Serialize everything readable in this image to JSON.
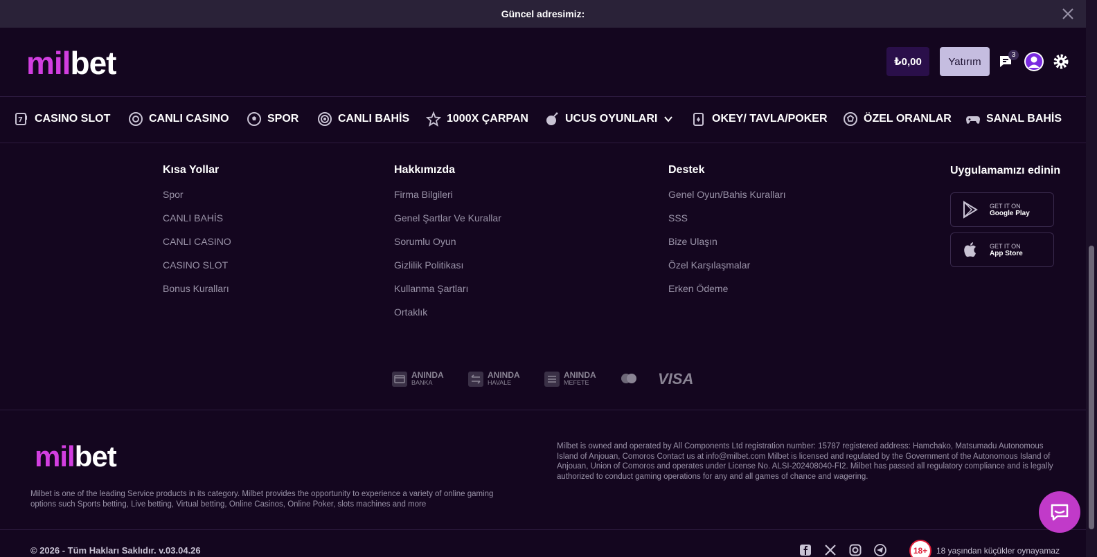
{
  "topbar": {
    "message": "Güncel adresimiz:"
  },
  "header": {
    "logo": {
      "part1": "mil",
      "part2": "bet"
    },
    "balance": "₺0,00",
    "deposit_label": "Yatırım",
    "notification_count": "3"
  },
  "nav": {
    "items": [
      {
        "label": "CASINO SLOT",
        "icon": "slot-icon"
      },
      {
        "label": "CANLI CASINO",
        "icon": "chip-icon"
      },
      {
        "label": "SPOR",
        "icon": "soccer-ball-icon"
      },
      {
        "label": "CANLI BAHİS",
        "icon": "live-icon"
      },
      {
        "label": "1000X ÇARPAN",
        "icon": "star-icon"
      },
      {
        "label": "UCUS OYUNLARI",
        "icon": "bomb-icon"
      },
      {
        "label": "OKEY/ TAVLA/POKER",
        "icon": "cards-icon"
      },
      {
        "label": "ÖZEL ORANLAR",
        "icon": "ball-icon"
      },
      {
        "label": "SANAL BAHİS",
        "icon": "gamepad-icon"
      }
    ]
  },
  "footer": {
    "columns": [
      {
        "title": "Kısa Yollar",
        "links": [
          "Spor",
          "CANLI BAHİS",
          "CANLI CASINO",
          "CASINO SLOT",
          "Bonus Kuralları"
        ]
      },
      {
        "title": "Hakkımızda",
        "links": [
          "Firma Bilgileri",
          "Genel Şartlar Ve Kurallar",
          "Sorumlu Oyun",
          "Gizlilik Politikası",
          "Kullanma Şartları",
          "Ortaklık"
        ]
      },
      {
        "title": "Destek",
        "links": [
          "Genel Oyun/Bahis Kuralları",
          "SSS",
          "Bize Ulaşın",
          "Özel Karşılaşmalar",
          "Erken Ödeme"
        ]
      }
    ],
    "app": {
      "title": "Uygulamamızı edinin",
      "google": {
        "small": "GET IT ON",
        "big": "Google Play"
      },
      "apple": {
        "small": "GET IT ON",
        "big": "App Store"
      }
    },
    "payments": [
      {
        "t1": "ANINDA",
        "t2": "BANKA"
      },
      {
        "t1": "ANINDA",
        "t2": "HAVALE"
      },
      {
        "t1": "ANINDA",
        "t2": "MEFETE"
      }
    ],
    "visa": "VISA",
    "about": "Milbet is one of the leading Service products in its category. Milbet provides the opportunity to experience a variety of online gaming options such Sports betting, Live betting, Virtual betting, Online Casinos, Online Poker, slots machines and more",
    "legal": "Milbet is owned and operated by All Components Ltd registration number: 15787 registered address: Hamchako, Matsumadu Autonomous Island of Anjouan, Comoros Contact us at info@milbet.com Milbet is licensed and regulated by the Government of the Autonomous Island of Anjouan, Union of Comoros and operates under License No. ALSI-202408040-FI2. Milbet has passed all regulatory compliance and is legally authorized to conduct gaming operations for any and all games of chance and wagering.",
    "copyright": "© 2026 - Tüm Hakları Saklıdır. v.03.04.26",
    "age_badge": "18+",
    "age_text": "18 yaşından küçükler oynayamaz"
  },
  "colors": {
    "background": "#14061f",
    "accent": "#d23ee0",
    "chat": "#c13ac9"
  }
}
